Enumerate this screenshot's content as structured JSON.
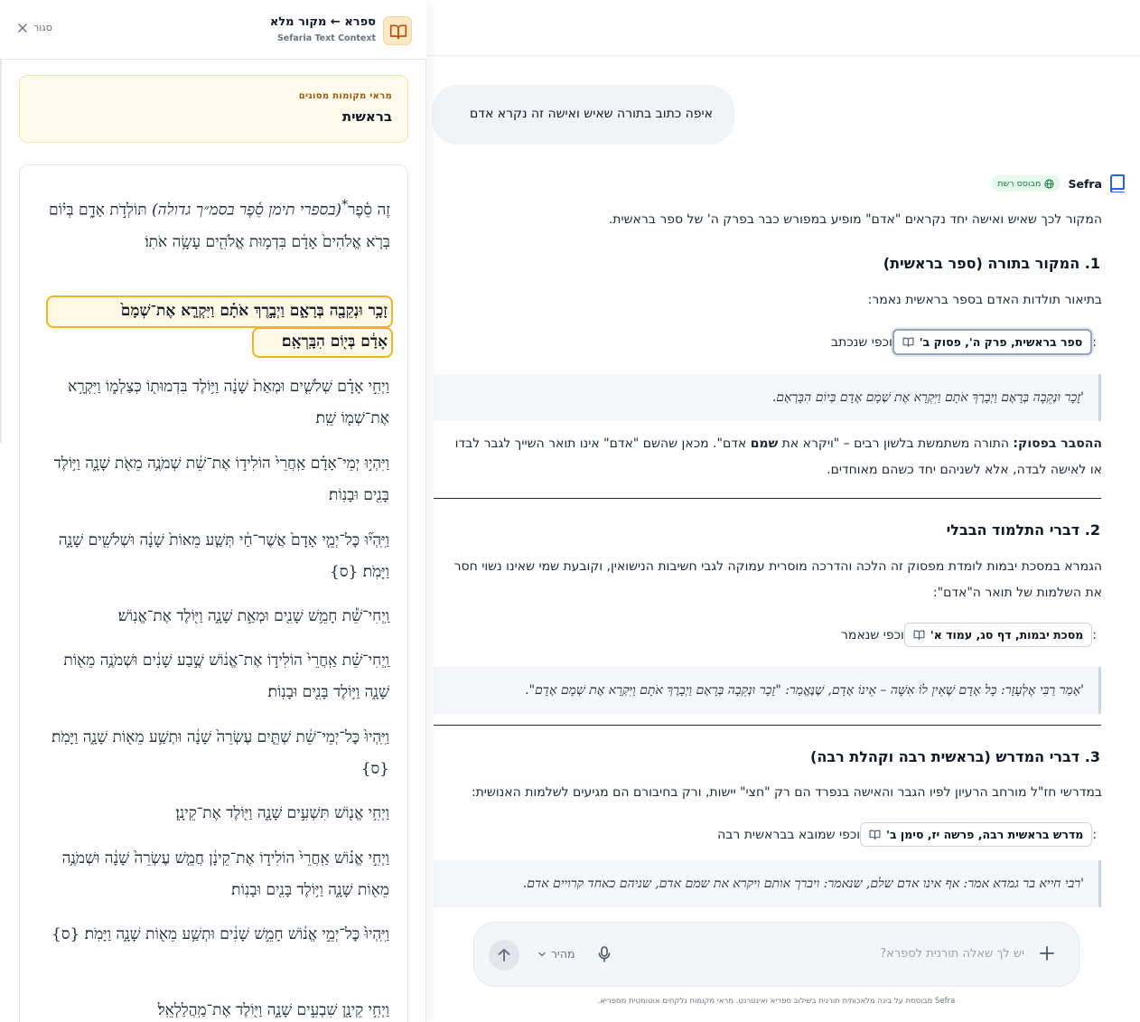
{
  "side_panel": {
    "title": "ספרא ← מקור מלא",
    "subtitle": "Sefaria Text Context",
    "close_label": "סגור",
    "source_card": {
      "label": "מראי מקומות מסוגים",
      "name": "בראשית"
    },
    "verses": [
      {
        "pre": "זֶה סֵ֫פֶר",
        "sup": "*",
        "ital": "(בספרי תימן סֵ֫פֶר בסמ״ך גדולה)",
        "post": " תּוֹלְדֹ֣ת אָדָ֑ם בְּי֗וֹם בְּרֹ֤א אֱלֹהִים֙ אָדָ֔ם בִּדְמ֥וּת אֱלֹהִ֖ים עָשָׂ֥ה אֹתֽוֹ׃"
      },
      {
        "highlight_line1": "זָכָ֥ר וּנְקֵבָ֖ה בְּרָאָ֑ם וַיְבָ֣רֶךְ אֹתָ֗ם וַיִּקְרָ֤א אֶת־שְׁמָם֙",
        "highlight_line2": "אָדָ֔ם בְּי֖וֹם הִבָּֽרְאָֽם׃"
      },
      {
        "text": "וַיְחִ֣י אָדָ֗ם שְׁלֹשִׁ֤ים וּמְאַת֙ שָׁנָ֔ה וַיּ֥וֹלֶד בִּדְמוּת֖וֹ כְּצַלְמ֑וֹ וַיִּקְרָ֥א אֶת־שְׁמ֖וֹ שֵֽׁת׃"
      },
      {
        "text": "וַיִּהְי֣וּ יְמֵי־אָדָ֗ם אַֽחֲרֵי֙ הוֹלִיד֣וֹ אֶת־שֵׁ֔ת שְׁמֹנֶ֥ה מֵאֹ֖ת שָׁנָ֑ה וַיּ֥וֹלֶד בָּנִ֖ים וּבָנֽוֹת׃"
      },
      {
        "text": "וַיִּֽהְי֞וּ כׇּל־יְמֵ֤י אָדָם֙ אֲשֶׁר־חַ֔י תְּשַׁ֤ע מֵאוֹת֙ שָׁנָ֔ה וּשְׁלֹשִׁ֖ים שָׁנָ֑ה וַיָּמֹֽת׃ {ס}"
      },
      {
        "text": "וַֽיְחִי־שֵׁ֕ת חָמֵ֥שׁ שָׁנִ֖ים וּמְאַ֣ת שָׁנָ֑ה וַיּ֖וֹלֶד אֶת־אֱנֽוֹשׁ׃"
      },
      {
        "text": "וַֽיְחִי־שֵׁ֗ת אַֽחֲרֵי֙ הוֹלִיד֣וֹ אֶת־אֱנ֔וֹשׁ שֶׁ֣בַע שָׁנִ֔ים וּשְׁמֹנֶ֥ה מֵא֖וֹת שָׁנָ֑ה וַיּ֥וֹלֶד בָּנִ֖ים וּבָנֽוֹת׃"
      },
      {
        "text": "וַיִּֽהְיוּ֙ כׇּל־יְמֵי־שֵׁ֔ת שְׁתֵּ֤ים עֶשְׂרֵה֙ שָׁנָ֔ה וּתְשַׁ֥ע מֵא֖וֹת שָׁנָ֑ה וַיָּמֹֽת׃ {ס}"
      },
      {
        "text": "וַיְחִ֥י אֱנ֖וֹשׁ תִּשְׁעִ֣ים שָׁנָ֑ה וַיּ֖וֹלֶד אֶת־קֵינָֽן׃"
      },
      {
        "text": "וַיְחִ֣י אֱנ֗וֹשׁ אַֽחֲרֵי֙ הוֹלִיד֣וֹ אֶת־קֵינָ֔ן חֲמֵ֤שׁ עֶשְׂרֵה֙ שָׁנָ֔ה וּשְׁמֹנֶ֥ה מֵא֖וֹת שָׁנָ֑ה וַיּ֥וֹלֶד בָּנִ֖ים וּבָנֽוֹת׃"
      },
      {
        "text": "וַיִּֽהְיוּ֙ כׇּל־יְמֵ֣י אֱנ֔וֹשׁ חָמֵ֣שׁ שָׁנִ֔ים וּתְשַׁ֥ע מֵא֖וֹת שָׁנָ֑ה וַיָּמֹֽת׃ {ס}"
      },
      {
        "text": "וַיְחִ֥י קֵינָ֖ן שִׁבְעִ֣ים שָׁנָ֑ה וַיּ֖וֹלֶד אֶת־מַֽהֲלַלְאֵֽל׃"
      }
    ]
  },
  "chat": {
    "user_message": "איפה כתוב בתורה שאיש ואישה זה נקרא אדם",
    "assistant_name": "Sefra",
    "web_badge": "מבוסס רשת",
    "intro": "המקור לכך שאיש ואישה יחד נקראים \"אדם\" מופיע במפורש כבר בפרק ה' של ספר בראשית.",
    "sections": [
      {
        "heading": "1. המקור בתורה (ספר בראשית)",
        "body": "בתיאור תולדות האדם בספר בראשית נאמר:",
        "cite_lead": "וכפי שנכתב",
        "cite_chip": "ספר בראשית, פרק ה', פסוק ב'",
        "quote": "'זָכָר וּנְקֵבָה בְּרָאָם וַיְבָרֶךְ אֹתָם וַיִּקְרָא אֶת שְׁמָם אָדָם בְּיוֹם הִבָּרְאָם.",
        "explain_label": "ההסבר בפסוק:",
        "explain_a": " התורה משתמשת בלשון רבים – \"ויקרא את ",
        "explain_bold": "שמם",
        "explain_b": " אדם\". מכאן שהשם \"אדם\" אינו תואר השייך לגבר לבדו או לאישה לבדה, אלא לשניהם יחד כשהם מאוחדים."
      },
      {
        "heading": "2. דברי התלמוד הבבלי",
        "body": "הגמרא במסכת יבמות לומדת מפסוק זה הלכה והדרכה מוסרית עמוקה לגבי חשיבות הנישואין, וקובעת שמי שאינו נשוי חסר את השלמות של תואר ה\"אדם\":",
        "cite_lead": "וכפי שנאמר",
        "cite_chip": "מסכת יבמות, דף סג, עמוד א'",
        "quote": "'אָמַר רַבִּי אֶלְעָזָר: כָּל אָדָם שֶׁאֵין לוֹ אִשָּׁה – אֵינוֹ אָדָם, שֶׁנֶּאֱמַר: \"זָכָר וּנְקֵבָה בְּרָאָם וַיְבָרֶךְ אֹתָם וַיִּקְרָא אֶת שְׁמָם אָדָם\"."
      },
      {
        "heading": "3. דברי המדרש (בראשית רבה וקהלת רבה)",
        "body": "במדרשי חז\"ל מורחב הרעיון לפיו הגבר והאישה בנפרד הם רק \"חצי\" יישות, ורק בחיבורם הם מגיעים לשלמות האנושית:",
        "cite_lead": "וכפי שמובא בבראשית רבה",
        "cite_chip": "מדרש בראשית רבה, פרשה יז, סימן ב'",
        "quote": "'רבי חייא בר גמדא אמר: אף אינו אדם שלם, שנאמר: ויברך אותם ויקרא את שמם אדם, שניהם כאחד קרויים אדם."
      }
    ]
  },
  "input": {
    "placeholder": "יש לך שאלה תורנית לספרא?",
    "mode": "מהיר",
    "footnote": "Sefra מבוססת על בינה מלאכותית תורנית בשילוב ספריא ואינטרנט. מראי מקומות נלקחים אוטומטית מספריא."
  },
  "colors": {
    "highlight_border": "#efb41f",
    "source_card_bg": "#fefbec",
    "web_badge": "#15803d",
    "assistant_icon": "#2563eb"
  },
  "icons": [
    "book-open-icon",
    "close-icon",
    "globe-icon",
    "book-icon",
    "plus-icon",
    "microphone-icon",
    "chevron-down-icon",
    "arrow-up-icon"
  ]
}
